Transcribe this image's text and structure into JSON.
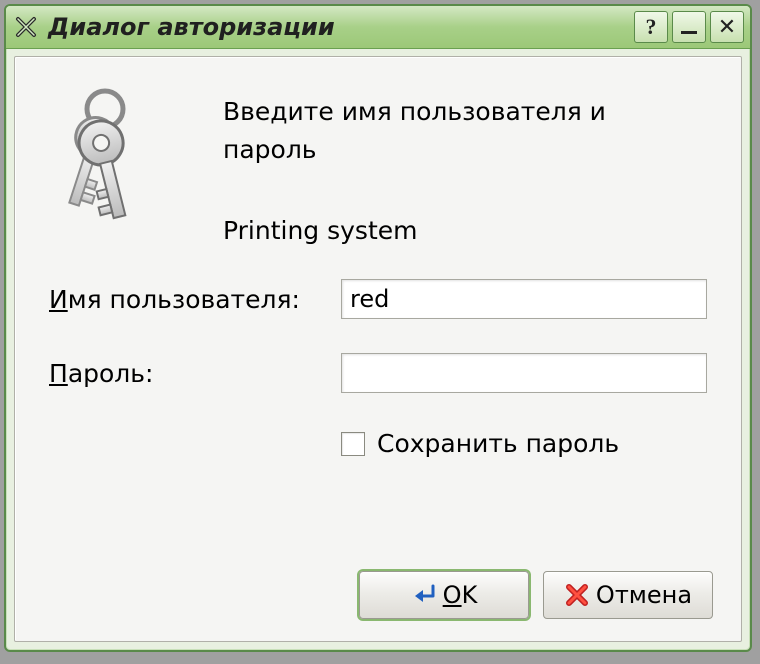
{
  "window": {
    "title": "Диалог авторизации"
  },
  "content": {
    "prompt": "Введите имя пользователя и пароль",
    "subsystem": "Printing system",
    "username_label_pre": "И",
    "username_label_rest": "мя пользователя:",
    "username_value": "red",
    "password_label_pre": "П",
    "password_label_rest": "ароль:",
    "password_value": "",
    "save_password_label": "Сохранить пароль",
    "save_password_checked": false
  },
  "buttons": {
    "ok_pre": "O",
    "ok_rest": "K",
    "cancel": "Отмена"
  }
}
